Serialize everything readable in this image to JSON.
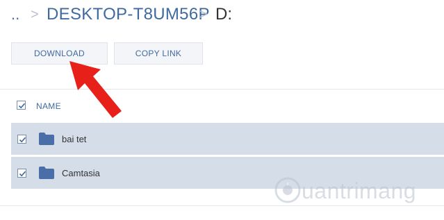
{
  "breadcrumb": {
    "parent": "..",
    "host": "DESKTOP-T8UM56P",
    "drive": "D:",
    "separator": ">"
  },
  "toolbar": {
    "download_label": "DOWNLOAD",
    "copy_link_label": "COPY LINK"
  },
  "table": {
    "header": "NAME",
    "rows": [
      {
        "name": "bai tet",
        "icon": "folder-icon",
        "checked": true
      },
      {
        "name": "Camtasia",
        "icon": "folder-icon",
        "checked": true
      }
    ]
  },
  "watermark": {
    "text": "uantrimang"
  },
  "colors": {
    "accent": "#3f6aa0",
    "row_selected": "#d5dde9",
    "annotation_arrow": "#e8201a"
  }
}
